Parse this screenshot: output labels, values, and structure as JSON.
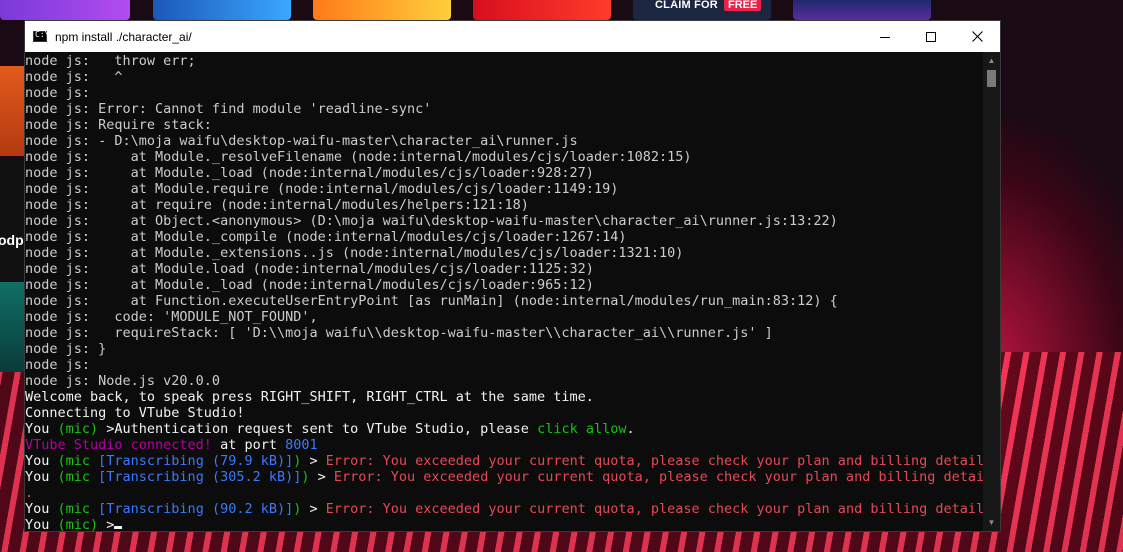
{
  "desktop": {
    "promo": {
      "claim_label": "CLAIM FOR",
      "free_label": "FREE"
    },
    "side_tile_label": "odp"
  },
  "window": {
    "title": "npm install ./character_ai/",
    "icon_glyph": "C:\\",
    "buttons": [
      "minimize",
      "maximize",
      "close"
    ]
  },
  "console": {
    "lines": [
      [
        {
          "t": "node js:   throw err;",
          "c": ""
        }
      ],
      [
        {
          "t": "node js:   ^",
          "c": ""
        }
      ],
      [
        {
          "t": "node js:",
          "c": ""
        }
      ],
      [
        {
          "t": "node js: Error: Cannot find module 'readline-sync'",
          "c": ""
        }
      ],
      [
        {
          "t": "node js: Require stack:",
          "c": ""
        }
      ],
      [
        {
          "t": "node js: - D:\\moja waifu\\desktop-waifu-master\\character_ai\\runner.js",
          "c": ""
        }
      ],
      [
        {
          "t": "node js:     at Module._resolveFilename (node:internal/modules/cjs/loader:1082:15)",
          "c": ""
        }
      ],
      [
        {
          "t": "node js:     at Module._load (node:internal/modules/cjs/loader:928:27)",
          "c": ""
        }
      ],
      [
        {
          "t": "node js:     at Module.require (node:internal/modules/cjs/loader:1149:19)",
          "c": ""
        }
      ],
      [
        {
          "t": "node js:     at require (node:internal/modules/helpers:121:18)",
          "c": ""
        }
      ],
      [
        {
          "t": "node js:     at Object.<anonymous> (D:\\moja waifu\\desktop-waifu-master\\character_ai\\runner.js:13:22)",
          "c": ""
        }
      ],
      [
        {
          "t": "node js:     at Module._compile (node:internal/modules/cjs/loader:1267:14)",
          "c": ""
        }
      ],
      [
        {
          "t": "node js:     at Module._extensions..js (node:internal/modules/cjs/loader:1321:10)",
          "c": ""
        }
      ],
      [
        {
          "t": "node js:     at Module.load (node:internal/modules/cjs/loader:1125:32)",
          "c": ""
        }
      ],
      [
        {
          "t": "node js:     at Module._load (node:internal/modules/cjs/loader:965:12)",
          "c": ""
        }
      ],
      [
        {
          "t": "node js:     at Function.executeUserEntryPoint [as runMain] (node:internal/modules/run_main:83:12) {",
          "c": ""
        }
      ],
      [
        {
          "t": "node js:   code: 'MODULE_NOT_FOUND',",
          "c": ""
        }
      ],
      [
        {
          "t": "node js:   requireStack: [ 'D:\\\\moja waifu\\\\desktop-waifu-master\\\\character_ai\\\\runner.js' ]",
          "c": ""
        }
      ],
      [
        {
          "t": "node js: }",
          "c": ""
        }
      ],
      [
        {
          "t": "node js:",
          "c": ""
        }
      ],
      [
        {
          "t": "node js: Node.js v20.0.0",
          "c": ""
        }
      ],
      [
        {
          "t": "Welcome back, to speak press RIGHT_SHIFT, RIGHT_CTRL at the same time.",
          "c": "white"
        }
      ],
      [
        {
          "t": "Connecting to VTube Studio!",
          "c": "white"
        }
      ],
      [
        {
          "t": "You ",
          "c": "white"
        },
        {
          "t": "(mic)",
          "c": "green"
        },
        {
          "t": " >Authentication request sent to VTube Studio, please ",
          "c": "white"
        },
        {
          "t": "click allow",
          "c": "green"
        },
        {
          "t": ".",
          "c": "white"
        }
      ],
      [
        {
          "t": "VTube Studio connected!",
          "c": "mag"
        },
        {
          "t": " at port ",
          "c": "white"
        },
        {
          "t": "8001",
          "c": "blue"
        }
      ],
      [
        {
          "t": "You ",
          "c": "white"
        },
        {
          "t": "(mic ",
          "c": "green"
        },
        {
          "t": "[Transcribing (79.9 kB)]",
          "c": "blue"
        },
        {
          "t": ")",
          "c": "green"
        },
        {
          "t": " > ",
          "c": "white"
        },
        {
          "t": "Error: You exceeded your current quota, please check your plan and billing details.",
          "c": "red"
        }
      ],
      [
        {
          "t": "You ",
          "c": "white"
        },
        {
          "t": "(mic ",
          "c": "green"
        },
        {
          "t": "[Transcribing (305.2 kB)]",
          "c": "blue"
        },
        {
          "t": ")",
          "c": "green"
        },
        {
          "t": " > ",
          "c": "white"
        },
        {
          "t": "Error: You exceeded your current quota, please check your plan and billing details",
          "c": "red"
        }
      ],
      [
        {
          "t": ".",
          "c": "red"
        }
      ],
      [
        {
          "t": "You ",
          "c": "white"
        },
        {
          "t": "(mic ",
          "c": "green"
        },
        {
          "t": "[Transcribing (90.2 kB)]",
          "c": "blue"
        },
        {
          "t": ")",
          "c": "green"
        },
        {
          "t": " > ",
          "c": "white"
        },
        {
          "t": "Error: You exceeded your current quota, please check your plan and billing details.",
          "c": "red"
        }
      ],
      [
        {
          "t": "You ",
          "c": "white"
        },
        {
          "t": "(mic)",
          "c": "green"
        },
        {
          "t": " >",
          "c": "white"
        }
      ]
    ],
    "colors": {
      "white": "#f2f2f2",
      "green": "#16c60c",
      "blue": "#3b78ff",
      "red": "#e74856",
      "mag": "#b4009e",
      "default": "#cccccc"
    }
  }
}
